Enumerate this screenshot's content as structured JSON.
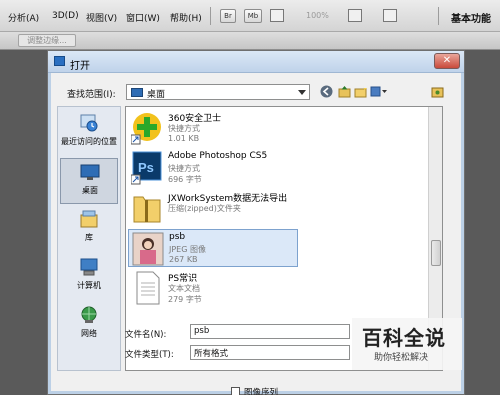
{
  "menubar": {
    "items": [
      "分析(A)",
      "3D(D)",
      "视图(V)",
      "窗口(W)",
      "帮助(H)"
    ],
    "btn_br": "Br",
    "btn_mb": "Mb",
    "zoom": "100%",
    "workspace": "基本功能"
  },
  "optbar": {
    "refine_edge": "调整边缘..."
  },
  "dialog": {
    "title": "打开",
    "lookin_label": "查找范围(I):",
    "lookin_value": "桌面",
    "places": [
      {
        "label": "最近访问的位置",
        "icon": "recent-places-icon"
      },
      {
        "label": "桌面",
        "icon": "desktop-icon"
      },
      {
        "label": "库",
        "icon": "library-icon"
      },
      {
        "label": "计算机",
        "icon": "computer-icon"
      },
      {
        "label": "网络",
        "icon": "network-icon"
      }
    ],
    "files": [
      {
        "name": "360安全卫士",
        "type": "快捷方式",
        "size": "1.01 KB",
        "icon": "360-security-icon"
      },
      {
        "name": "Adobe Photoshop CS5",
        "type": "快捷方式",
        "size": "696 字节",
        "icon": "photoshop-icon"
      },
      {
        "name": "JXWorkSystem数据无法导出",
        "type": "压缩(zipped)文件夹",
        "size": "",
        "icon": "zip-folder-icon"
      },
      {
        "name": "psb",
        "type": "JPEG 图像",
        "size": "267 KB",
        "icon": "jpeg-thumbnail-icon"
      },
      {
        "name": "PS常识",
        "type": "文本文档",
        "size": "279 字节",
        "icon": "text-document-icon"
      }
    ],
    "filename_label": "文件名(N):",
    "filename_value": "psb",
    "filetype_label": "文件类型(T):",
    "filetype_value": "所有格式",
    "image_sequence_label": "图像序列"
  },
  "watermark": {
    "title": "百科全说",
    "subtitle": "助你轻松解决"
  },
  "colors": {
    "title_bar": "#bfd3ea",
    "selection": "#dbe8f8",
    "close": "#c94a3b"
  }
}
